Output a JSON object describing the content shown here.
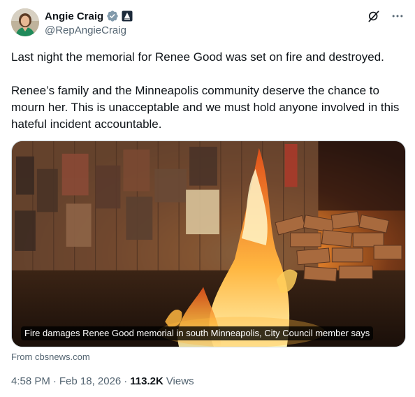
{
  "author": {
    "name": "Angie Craig",
    "handle": "@RepAngieCraig"
  },
  "post": {
    "paragraph1": "Last night the memorial for Renee Good was set on fire and destroyed.",
    "paragraph2": "Renee’s family and the Minneapolis community deserve the chance to mourn her. This is unacceptable and we must hold anyone involved in this hateful incident accountable."
  },
  "media": {
    "caption": "Fire damages Renee Good memorial in south Minneapolis, City Council member says",
    "source": "From cbsnews.com"
  },
  "meta": {
    "time": "4:58 PM",
    "date": "Feb 18, 2026",
    "separator": "·",
    "views_count": "113.2K",
    "views_label": "Views"
  },
  "icons": {
    "verified": "verified-badge-icon",
    "government": "government-badge-icon",
    "grok": "grok-icon",
    "more": "more-icon"
  },
  "colors": {
    "text": "#0f1419",
    "secondary": "#536471",
    "verified_gray": "#829aab",
    "border": "#cfd9de"
  }
}
